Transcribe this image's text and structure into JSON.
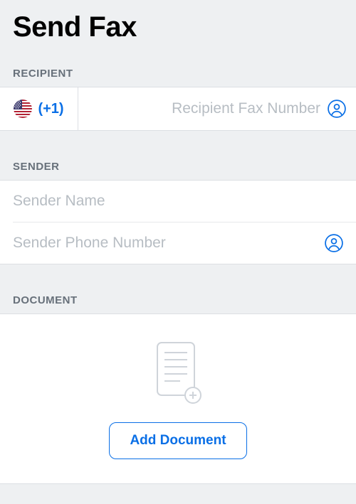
{
  "header": {
    "title": "Send Fax"
  },
  "sections": {
    "recipient_label": "RECIPIENT",
    "sender_label": "SENDER",
    "document_label": "DOCUMENT"
  },
  "recipient": {
    "country_code": "(+1)",
    "fax_placeholder": "Recipient Fax Number",
    "fax_value": ""
  },
  "sender": {
    "name_placeholder": "Sender Name",
    "name_value": "",
    "phone_placeholder": "Sender Phone Number",
    "phone_value": ""
  },
  "document": {
    "add_button_label": "Add Document"
  },
  "colors": {
    "accent": "#0a6fe6"
  }
}
